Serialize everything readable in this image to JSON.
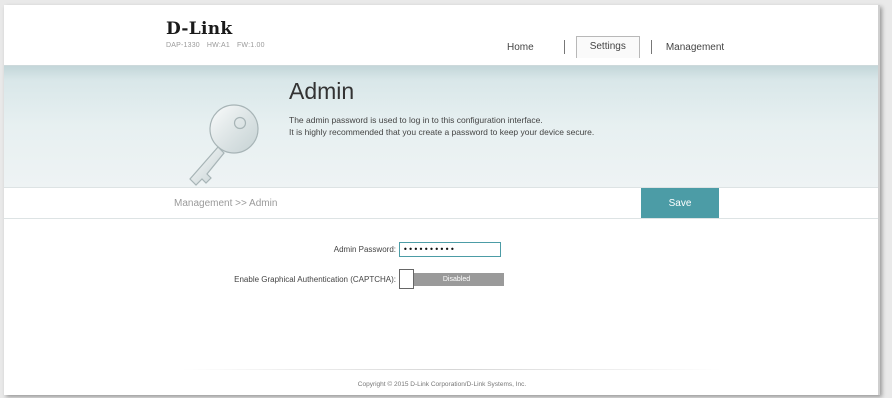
{
  "brand": {
    "logo": "D-Link",
    "model": "DAP-1330",
    "hw": "HW:A1",
    "fw": "FW:1.00"
  },
  "nav": {
    "home": "Home",
    "settings": "Settings",
    "management": "Management",
    "active": "Settings"
  },
  "hero": {
    "title": "Admin",
    "line1": "The admin password is used to log in to this configuration interface.",
    "line2": "It is highly recommended that you create a password to keep your device secure.",
    "icon": "key-icon"
  },
  "breadcrumb": "Management >> Admin",
  "save_label": "Save",
  "form": {
    "password_label": "Admin Password:",
    "password_value": "••••••••••",
    "captcha_label": "Enable Graphical Authentication (CAPTCHA):",
    "captcha_state": "Disabled"
  },
  "footer": "Copyright © 2015 D-Link Corporation/D-Link Systems, Inc.",
  "colors": {
    "accent": "#4c9ca6",
    "toggle_off": "#9a9a9a",
    "banner": "#d9e7e9"
  }
}
